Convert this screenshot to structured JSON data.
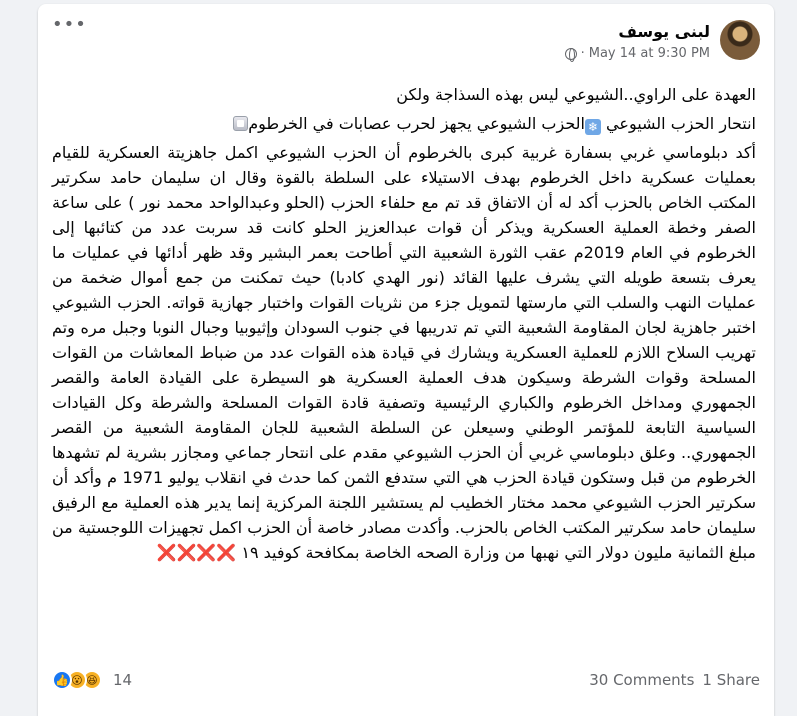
{
  "author": {
    "name": "لبنى يوسف"
  },
  "timestamp": "May 14 at 9:30 PM",
  "paragraphs": {
    "p1": "العهدة على الراوي..الشيوعي ليس بهذه السذاجة ولكن",
    "p2a": "انتحار الحزب الشيوعي ",
    "p2b": "الحزب الشيوعي يجهز لحرب عصابات في الخرطوم",
    "p3": "أكد دبلوماسي غربي بسفارة غربية كبرى بالخرطوم  أن الحزب الشيوعي اكمل جاهزيتة العسكرية للقيام بعمليات عسكرية داخل الخرطوم بهدف الاستيلاء على السلطة بالقوة وقال ان سليمان حامد سكرتير المكتب الخاص بالحزب أكد له أن الاتفاق قد تم مع حلفاء الحزب (الحلو وعبدالواحد محمد نور ) على ساعة الصفر وخطة العملية العسكرية  ويذكر أن قوات عبدالعزيز الحلو كانت قد سربت عدد من كتائبها إلى الخرطوم في العام 2019م عقب الثورة الشعبية التي أطاحت بعمر البشير وقد ظهر أدائها في عمليات ما يعرف بتسعة طويله التي يشرف عليها القائد (نور الهدي كادبا) حيث تمكنت من جمع أموال ضخمة من عمليات النهب والسلب التي مارستها  لتمويل جزء من نثريات القوات واختبار جهازية قواته. الحزب الشيوعي اختبر جاهزية لجان المقاومة الشعبية التي تم تدريبها في جنوب السودان وإثيوبيا وجبال النوبا وجبل مره وتم تهريب السلاح اللازم للعملية العسكرية ويشارك في قيادة هذه القوات عدد من ضباط المعاشات من القوات المسلحة وقوات الشرطة وسيكون هدف العملية العسكرية هو السيطرة على القيادة العامة والقصر الجمهوري ومداخل الخرطوم والكباري الرئيسية وتصفية قادة القوات المسلحة والشرطة وكل القيادات السياسية التابعة للمؤتمر الوطني وسيعلن عن السلطة الشعبية  للجان المقاومة الشعبية من القصر الجمهوري.. وعلق دبلوماسي غربي أن الحزب الشيوعي مقدم على انتحار جماعي ومجازر بشرية لم تشهدها الخرطوم من قبل وستكون قيادة الحزب هي التي ستدفع الثمن كما حدث في انقلاب يوليو 1971 م وأكد أن سكرتير الحزب الشيوعي محمد مختار الخطيب لم يستشير اللجنة المركزية إنما يدير هذه العملية مع الرفيق سليمان حامد سكرتير المكتب الخاص بالحزب.  وأكدت مصادر خاصة أن الحزب اكمل تجهيزات اللوجستية من مبلغ الثمانية مليون دولار التي نهبها من وزارة الصحه الخاصة بمكافحة كوفيد ١٩ ",
    "p3_marks": "❌❌❌❌"
  },
  "reactions": {
    "icons": [
      "like-icon",
      "wow-icon",
      "haha-icon"
    ],
    "count": "14"
  },
  "stats": {
    "comments": "30 Comments",
    "shares": "1 Share"
  },
  "colors": {
    "reaction_blue": "#1877f2",
    "meta_gray": "#65676b",
    "mark_red": "#e0245e"
  }
}
